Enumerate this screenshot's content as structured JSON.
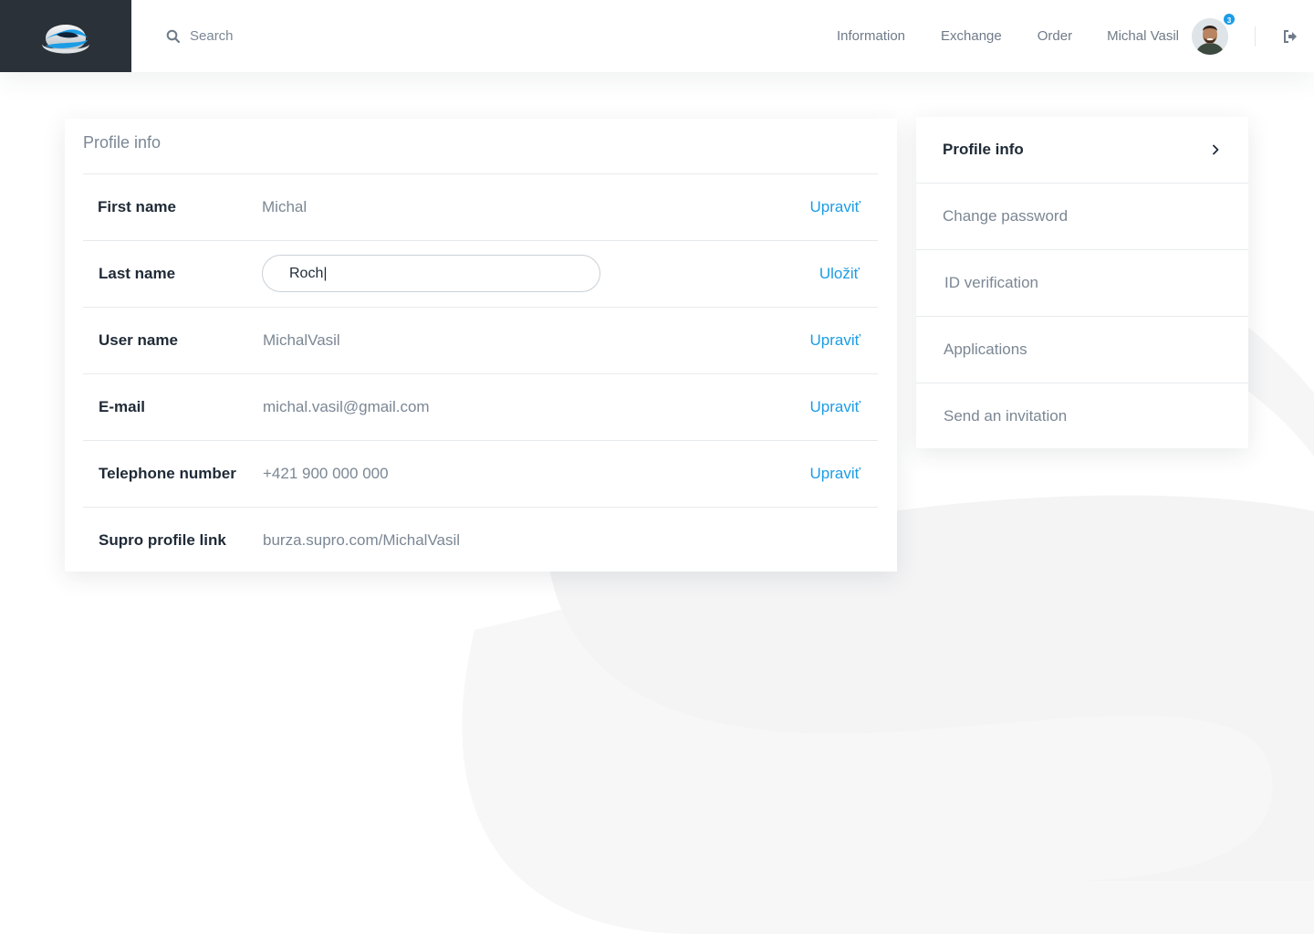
{
  "header": {
    "search_placeholder": "Search",
    "nav": [
      {
        "label": "Information"
      },
      {
        "label": "Exchange"
      },
      {
        "label": "Order"
      }
    ],
    "user_name": "Michal Vasil",
    "notification_count": "3",
    "icons": {
      "logo": "supro-logo",
      "search": "search-icon",
      "logout": "logout-icon"
    }
  },
  "profile_card": {
    "title": "Profile info",
    "rows": [
      {
        "label": "First name",
        "value": "Michal",
        "action": "Upraviť"
      },
      {
        "label": "Last name",
        "input_value": "Roch|",
        "action": "Uložiť"
      },
      {
        "label": "User name",
        "value": "MichalVasil",
        "action": "Upraviť"
      },
      {
        "label": "E-mail",
        "value": "michal.vasil@gmail.com",
        "action": "Upraviť"
      },
      {
        "label": "Telephone number",
        "value": "+421 900 000 000",
        "action": "Upraviť"
      },
      {
        "label": "Supro profile link",
        "value": "burza.supro.com/MichalVasil"
      }
    ]
  },
  "side_menu": {
    "items": [
      {
        "label": "Profile info",
        "active": true,
        "icon": "chevron-right-icon"
      },
      {
        "label": "Change password"
      },
      {
        "label": "ID verification"
      },
      {
        "label": "Applications"
      },
      {
        "label": "Send an invitation"
      }
    ]
  },
  "colors": {
    "accent": "#1c9ce5",
    "header_logo_bg": "#2b3138",
    "text_dark": "#1f2a36",
    "text_muted": "#7b8794",
    "divider": "#e7eaed"
  }
}
